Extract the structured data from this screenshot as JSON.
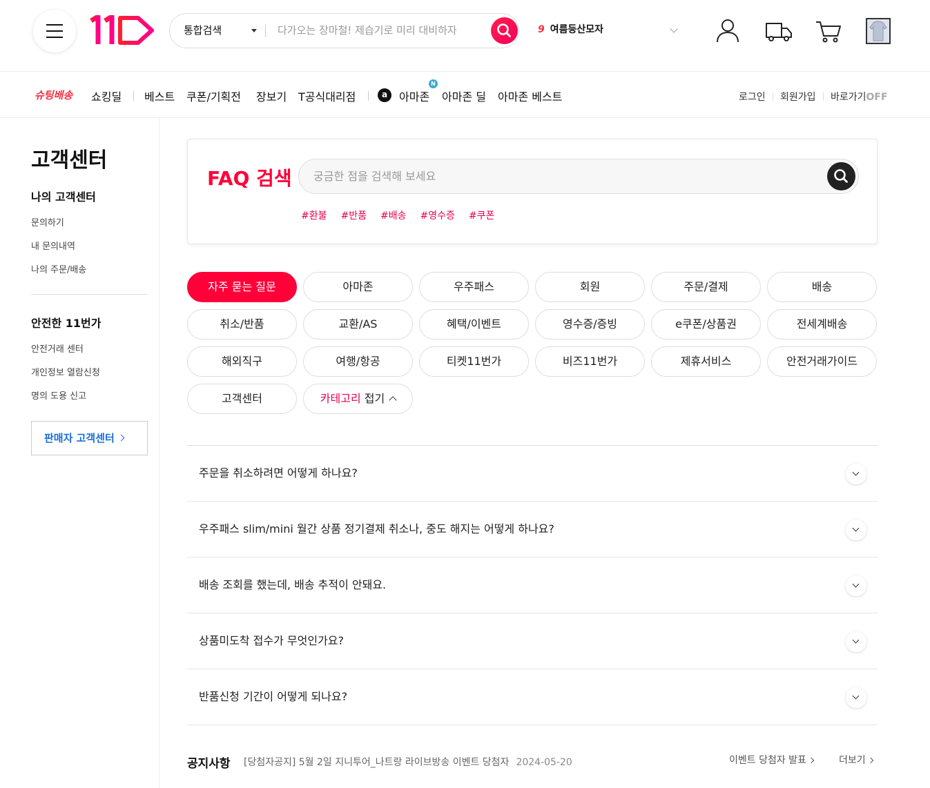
{
  "header": {
    "search_category": "통합검색",
    "search_placeholder": "다가오는 장마철! 제습기로 미리 대비하자",
    "trend_rank": "9",
    "trend_keyword": "여름등산모자"
  },
  "gnb": {
    "shooting": "슈팅배송",
    "items": [
      "쇼킹딜",
      "베스트",
      "쿠폰/기획전",
      "장보기",
      "T공식대리점",
      "아마존",
      "아마존 딜",
      "아마존 베스트"
    ],
    "amazon_badge": "N",
    "amazon_logo": "a",
    "util": {
      "login": "로그인",
      "signup": "회원가입",
      "shortcut": "바로가기",
      "shortcut_state": "OFF"
    }
  },
  "sidebar": {
    "title": "고객센터",
    "section1": {
      "title": "나의 고객센터",
      "links": [
        "문의하기",
        "내 문의내역",
        "나의 주문/배송"
      ]
    },
    "section2": {
      "title": "안전한 11번가",
      "links": [
        "안전거래 센터",
        "개인정보 열람신청",
        "명의 도용 신고"
      ]
    },
    "seller_button": "판매자 고객센터"
  },
  "faq_search": {
    "title": "FAQ 검색",
    "placeholder": "궁금한 점을 검색해 보세요",
    "tags": [
      "#환불",
      "#반품",
      "#배송",
      "#영수증",
      "#쿠폰"
    ]
  },
  "categories": [
    "자주 묻는 질문",
    "아마존",
    "우주패스",
    "회원",
    "주문/결제",
    "배송",
    "취소/반품",
    "교환/AS",
    "혜택/이벤트",
    "영수증/증빙",
    "e쿠폰/상품권",
    "전세계배송",
    "해외직구",
    "여행/항공",
    "티켓11번가",
    "비즈11번가",
    "제휴서비스",
    "안전거래가이드",
    "고객센터"
  ],
  "category_fold": {
    "accent": "카테고리",
    "suffix": " 접기"
  },
  "faqs": [
    "주문을 취소하려면 어떻게 하나요?",
    "우주패스 slim/mini 월간 상품 정기결제 취소나, 중도 해지는 어떻게 하나요?",
    "배송 조회를 했는데, 배송 추적이 안돼요.",
    "상품미도착 접수가 무엇인가요?",
    "반품신청 기간이 어떻게 되나요?"
  ],
  "notice": {
    "label": "공지사항",
    "text": "[당첨자공지] 5월 2일 지니투어_나트랑 라이브방송 이벤트 당첨자",
    "date": "2024-05-20",
    "winner_link": "이벤트 당첨자 발표",
    "more": "더보기"
  },
  "colors": {
    "brand": "#ff0038",
    "tag": "#e6004c",
    "seller": "#1a6fd8"
  },
  "icons": [
    "menu-icon",
    "search-icon",
    "user-icon",
    "delivery-truck-icon",
    "cart-icon",
    "recent-item-thumbnail"
  ]
}
